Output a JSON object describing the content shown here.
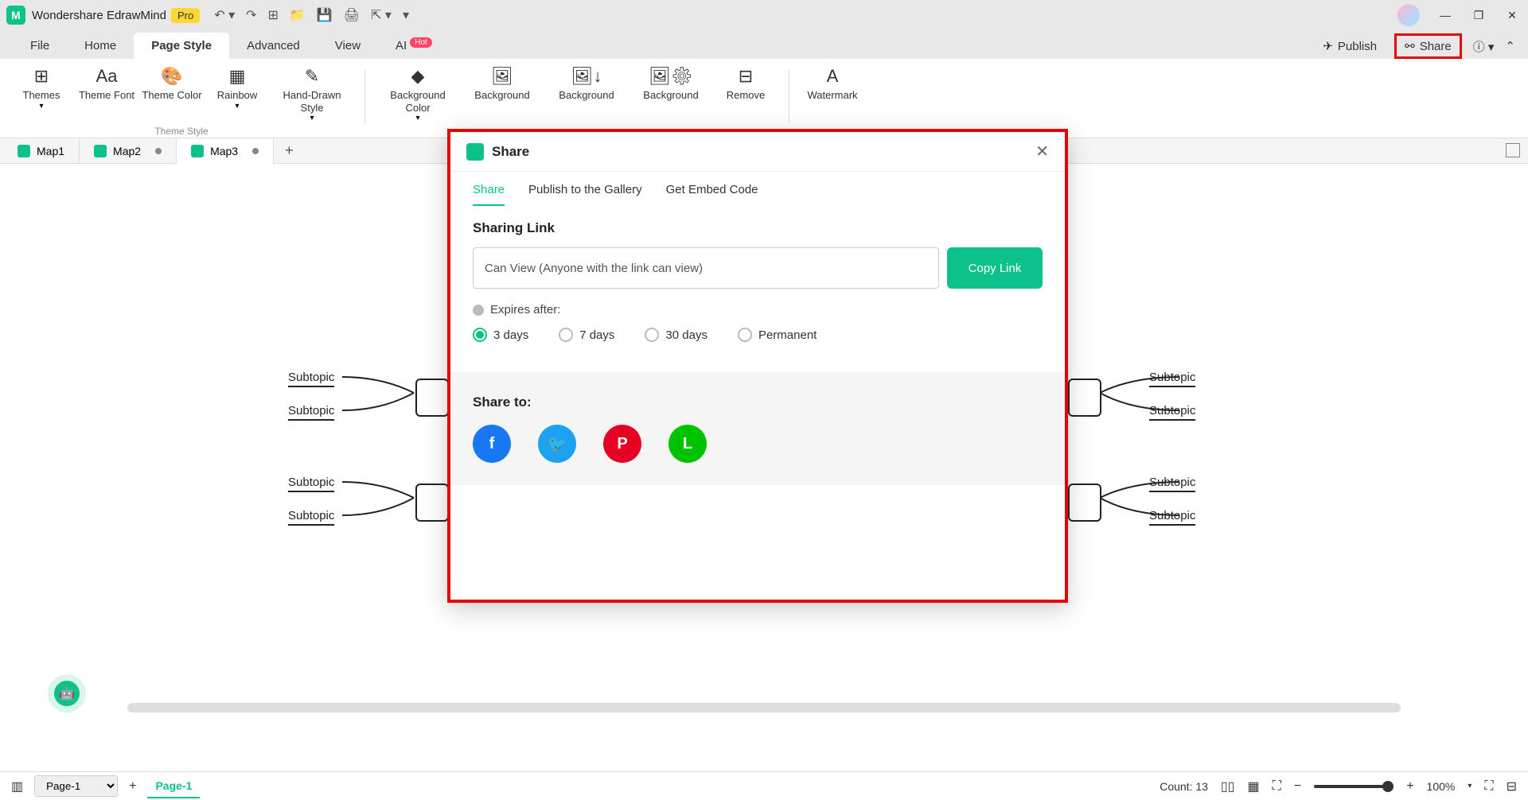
{
  "app": {
    "title": "Wondershare EdrawMind",
    "badge": "Pro"
  },
  "menu": {
    "items": [
      "File",
      "Home",
      "Page Style",
      "Advanced",
      "View",
      "AI"
    ],
    "hot_label": "Hot",
    "publish": "Publish",
    "share": "Share"
  },
  "ribbon": {
    "themes": "Themes",
    "theme_font": "Theme Font",
    "theme_color": "Theme Color",
    "rainbow": "Rainbow",
    "hand_drawn": "Hand-Drawn Style",
    "group_label": "Theme Style",
    "bg_color": "Background Color",
    "bg1": "Background",
    "bg2": "Background",
    "bg3": "Background",
    "remove": "Remove",
    "watermark": "Watermark"
  },
  "tabs": {
    "map1": "Map1",
    "map2": "Map2",
    "map3": "Map3"
  },
  "dialog": {
    "title": "Share",
    "tab_share": "Share",
    "tab_publish": "Publish to the Gallery",
    "tab_embed": "Get Embed Code",
    "section_link": "Sharing Link",
    "link_value": "Can View (Anyone with the link can view)",
    "copy_btn": "Copy Link",
    "expires_label": "Expires after:",
    "opt_3days": "3 days",
    "opt_7days": "7 days",
    "opt_30days": "30 days",
    "opt_permanent": "Permanent",
    "share_to": "Share to:"
  },
  "canvas": {
    "subtopic": "Subtopic"
  },
  "status": {
    "page_select": "Page-1",
    "page_tab": "Page-1",
    "count": "Count: 13",
    "zoom": "100%"
  }
}
